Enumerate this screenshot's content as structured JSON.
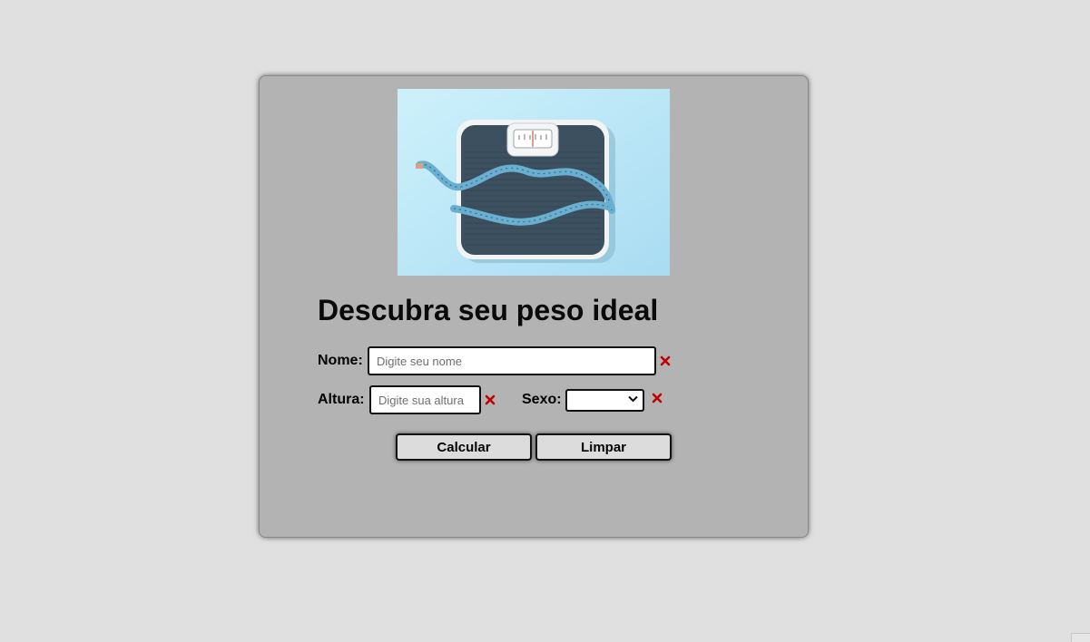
{
  "form": {
    "image_alt": "scale-with-measuring-tape",
    "title": "Descubra seu peso ideal",
    "name_label": "Nome:",
    "name_placeholder": "Digite seu nome",
    "name_value": "",
    "height_label": "Altura:",
    "height_placeholder": "Digite sua altura",
    "height_value": "",
    "sex_label": "Sexo:",
    "sex_selected": "",
    "calc_button": "Calcular",
    "clear_button": "Limpar"
  },
  "icons": {
    "error": "close-icon",
    "dropdown": "chevron-down-icon"
  },
  "colors": {
    "page_bg": "#e0e0e0",
    "card_bg": "#b3b3b3",
    "error": "#c00000",
    "button_bg": "#dcdcdc"
  }
}
